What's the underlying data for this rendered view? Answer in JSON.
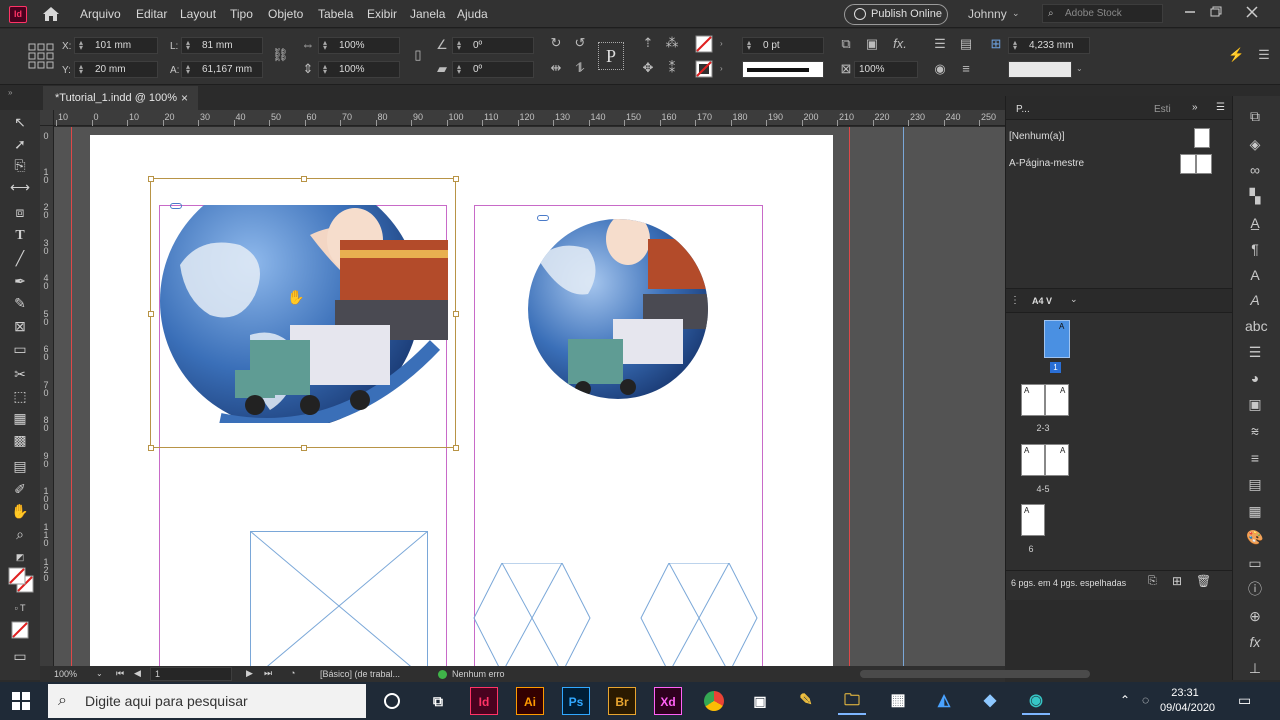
{
  "app": {
    "logo": "Id"
  },
  "menu": [
    "Arquivo",
    "Editar",
    "Layout",
    "Tipo",
    "Objeto",
    "Tabela",
    "Exibir",
    "Janela",
    "Ajuda"
  ],
  "header": {
    "publish_label": "Publish Online",
    "user": "Johnny",
    "stock_placeholder": "Adobe Stock"
  },
  "control": {
    "x_label": "X:",
    "x_value": "101 mm",
    "y_label": "Y:",
    "y_value": "20 mm",
    "l_label": "L:",
    "l_value": "81 mm",
    "a_label": "A:",
    "a_value": "61,167 mm",
    "scale_x": "100%",
    "scale_y": "100%",
    "rotate": "0º",
    "shear": "0º",
    "stroke_weight": "0 pt",
    "opacity": "100%",
    "fit_value": "4,233 mm"
  },
  "document": {
    "tab_title": "*Tutorial_1.indd @ 100%",
    "close": "×"
  },
  "ruler": {
    "h_ticks": [
      "10",
      "0",
      "10",
      "20",
      "30",
      "40",
      "50",
      "60",
      "70",
      "80",
      "90",
      "100",
      "110",
      "120",
      "130",
      "140",
      "150",
      "160",
      "170",
      "180",
      "190",
      "200",
      "210",
      "220",
      "230",
      "240",
      "250"
    ],
    "v_ticks": [
      "0",
      "1 0",
      "2 0",
      "3 0",
      "4 0",
      "5 0",
      "6 0",
      "7 0",
      "8 0",
      "9 0",
      "1 0 0",
      "1 1 0",
      "1 2 0"
    ]
  },
  "status": {
    "zoom": "100%",
    "page": "1",
    "profile": "[Básico] (de trabal...",
    "preflight": "Nenhum erro"
  },
  "pages_panel": {
    "tab_pages": "P...",
    "tab_styles": "Esti",
    "none_label": "[Nenhum(a)]",
    "master_label": "A-Página-mestre",
    "size_label": "A4 V",
    "spreads": [
      {
        "label": "1",
        "master": "A"
      },
      {
        "label": "2-3",
        "master": "A"
      },
      {
        "label": "4-5",
        "master": "A"
      },
      {
        "label": "6",
        "master": "A"
      }
    ],
    "summary": "6 pgs. em 4 pgs. espelhadas"
  },
  "taskbar": {
    "search_placeholder": "Digite aqui para pesquisar",
    "time": "23:31",
    "date": "09/04/2020",
    "apps": [
      "Id",
      "Ai",
      "Ps",
      "Br",
      "Xd"
    ]
  },
  "colors": {
    "accent": "#ff3366",
    "frame_selection": "#c8a040",
    "margin_guide": "#c86ac8",
    "globe_blue": "#3a6fb8"
  }
}
